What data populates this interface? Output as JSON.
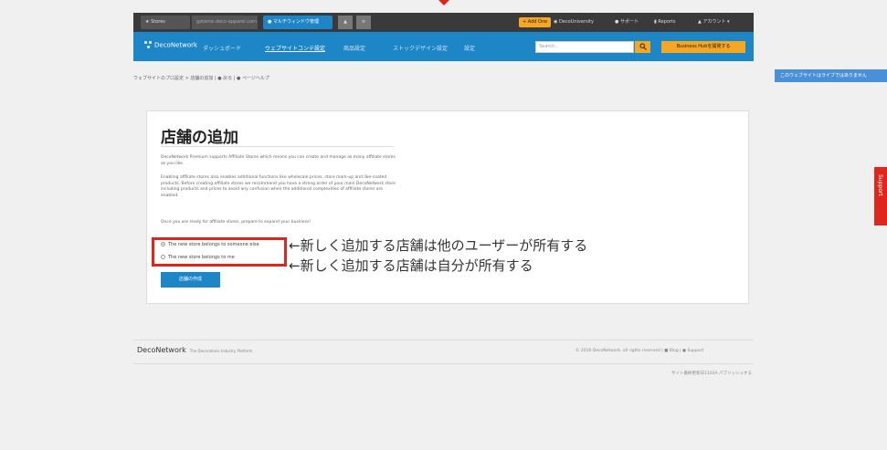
{
  "topbar": {
    "stores_tab": "★ Stores",
    "url_tab": "gateme.deco-apparel.com",
    "manage_tab": "● マルチウィンドウ管理",
    "add_one": "+ Add One",
    "decouniversity": "DecoUniversity",
    "support": "サポート",
    "reports": "Reports",
    "account": "アカウント ▾"
  },
  "navbar": {
    "logo": "DecoNetwork",
    "items": [
      "ダッシュボード",
      "ウェブサイトコンテ設定",
      "商品設定",
      "ストックデザイン設定",
      "設定"
    ],
    "search_placeholder": "Search...",
    "business_button": "Business Hubを開発する"
  },
  "breadcrumb": "ウェブサイトのプロ設定 > 店舗の追加 | ● 戻る | ● ページヘルプ",
  "side_note": "このウェブサイトはライブではありません",
  "support_tab": "Support",
  "card": {
    "title": "店舗の追加",
    "para1": "DecoNetwork Premium supports Affiliate Stores which means you can create and manage as many affiliate stores as you like.",
    "para2": "Enabling affiliate stores also enables additional functions like wholesale prices, store mark-up and like-coated products. Before creating affiliate stores we recommend you have a strong order of your main DecoNetwork store including products and prices to avoid any confusion when the additional complexities of affiliate stores are enabled.",
    "para3": "Once you are ready for affiliate stores, prepare to expand your business!",
    "radio1": "The new store belongs to someone else",
    "radio2": "The new store belongs to me",
    "create_button": "店舗の作成"
  },
  "annotations": {
    "line1": "←新しく追加する店舗は他のユーザーが所有する",
    "line2": "←新しく追加する店舗は自分が所有する"
  },
  "footer": {
    "logo": "DecoNetwork",
    "tagline": "The Decorations Industry Platform",
    "copyright": "© 2016 DecoNetwork. all rights reserved | ■ Blog | ● Support",
    "sub": "サイト最終更新日1102A パブリッシュする"
  }
}
